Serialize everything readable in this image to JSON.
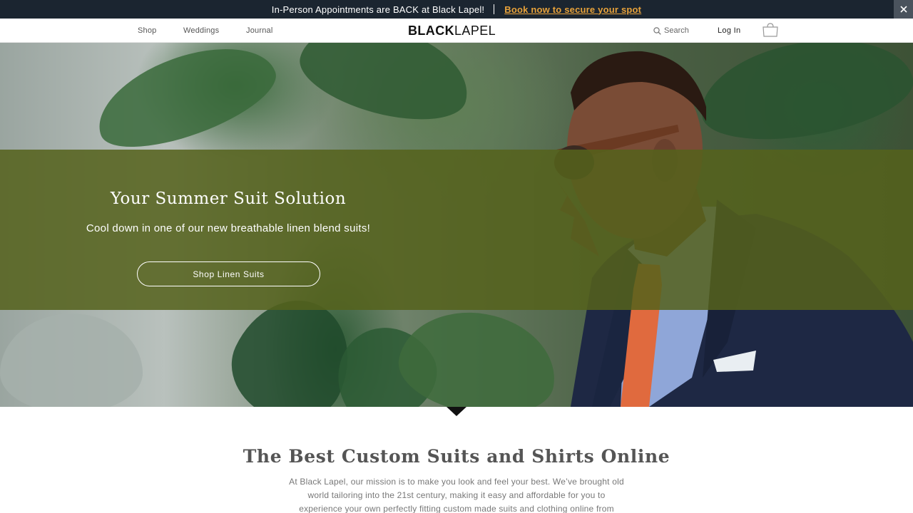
{
  "announcement": {
    "text": "In-Person Appointments are BACK at Black Lapel!",
    "link": "Book now to secure your spot",
    "close_label": "✕"
  },
  "header": {
    "nav": [
      {
        "label": "Shop"
      },
      {
        "label": "Weddings"
      },
      {
        "label": "Journal"
      }
    ],
    "logo_bold": "BLACK",
    "logo_thin": "LAPEL",
    "search_label": "Search",
    "login_label": "Log In",
    "icons": {
      "search": "search-icon",
      "cart": "shopping-bag-icon"
    }
  },
  "hero": {
    "title": "Your Summer Suit Solution",
    "subtitle": "Cool down in one of our new breathable linen blend suits!",
    "cta_label": "Shop Linen Suits",
    "overlay_color": "#55621c"
  },
  "intro": {
    "title": "The Best Custom Suits and Shirts Online",
    "body": "At Black Lapel, our mission is to make you look and feel your best. We’ve brought old world tailoring into the 21st century, making it easy and affordable for you to experience your own perfectly fitting custom made suits and clothing online from"
  },
  "colors": {
    "announce_bg": "#1b2530",
    "announce_link": "#e8a23a"
  }
}
